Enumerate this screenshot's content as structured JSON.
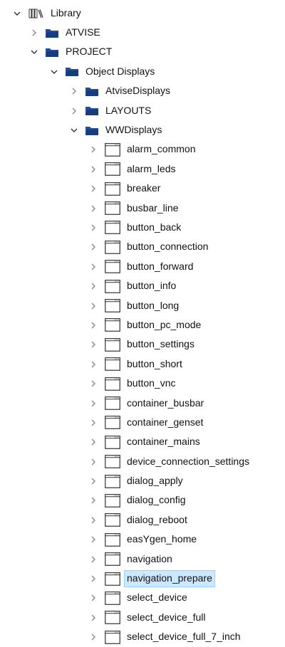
{
  "tree": {
    "root": {
      "label": "Library",
      "expanded": true,
      "icon": "library-icon"
    },
    "atvise": {
      "label": "ATVISE",
      "expanded": false,
      "icon": "folder-icon"
    },
    "project": {
      "label": "PROJECT",
      "expanded": true,
      "icon": "folder-icon"
    },
    "object_displays": {
      "label": "Object Displays",
      "expanded": true,
      "icon": "folder-icon"
    },
    "atvise_displays": {
      "label": "AtviseDisplays",
      "expanded": false,
      "icon": "folder-icon"
    },
    "layouts": {
      "label": "LAYOUTS",
      "expanded": false,
      "icon": "folder-icon"
    },
    "ww_displays": {
      "label": "WWDisplays",
      "expanded": true,
      "icon": "folder-icon"
    },
    "displays": [
      {
        "label": "alarm_common"
      },
      {
        "label": "alarm_leds"
      },
      {
        "label": "breaker"
      },
      {
        "label": "busbar_line"
      },
      {
        "label": "button_back"
      },
      {
        "label": "button_connection"
      },
      {
        "label": "button_forward"
      },
      {
        "label": "button_info"
      },
      {
        "label": "button_long"
      },
      {
        "label": "button_pc_mode"
      },
      {
        "label": "button_settings"
      },
      {
        "label": "button_short"
      },
      {
        "label": "button_vnc"
      },
      {
        "label": "container_busbar"
      },
      {
        "label": "container_genset"
      },
      {
        "label": "container_mains"
      },
      {
        "label": "device_connection_settings"
      },
      {
        "label": "dialog_apply"
      },
      {
        "label": "dialog_config"
      },
      {
        "label": "dialog_reboot"
      },
      {
        "label": "easYgen_home"
      },
      {
        "label": "navigation"
      },
      {
        "label": "navigation_prepare",
        "selected": true
      },
      {
        "label": "select_device"
      },
      {
        "label": "select_device_full"
      },
      {
        "label": "select_device_full_7_inch"
      }
    ]
  },
  "colors": {
    "folder": "#1f4e9c",
    "folder_dark": "#163c7a",
    "chevron_expanded": "#333333",
    "chevron_collapsed": "#8a8a8a",
    "selection_bg": "#cce8ff",
    "selection_border": "#99d1ff",
    "doc_border": "#333333",
    "doc_titlebar": "#666666"
  }
}
